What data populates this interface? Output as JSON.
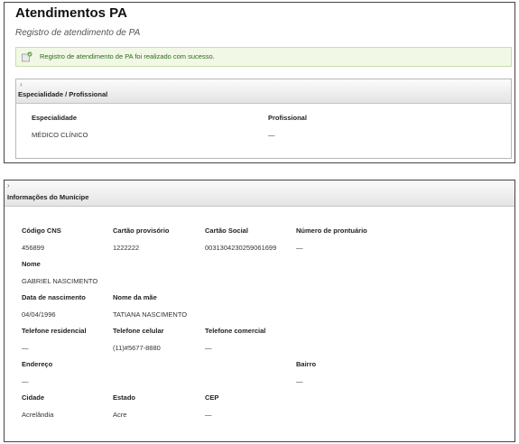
{
  "header": {
    "title": "Atendimentos PA",
    "subtitle": "Registro de atendimento de PA"
  },
  "alert": {
    "message": "Registro de atendimento de PA foi realizado com sucesso.",
    "icon": "success-message-icon"
  },
  "especialidade_section": {
    "toggle_icon": "›",
    "title": "Especialidade / Profissional",
    "fields": [
      {
        "label": "Especialidade",
        "value": "MÉDICO CLÍNICO"
      },
      {
        "label": "Profissional",
        "value": "—"
      }
    ]
  },
  "municipe_section": {
    "toggle_icon": "›",
    "title": "Informações do Munícipe",
    "fields": {
      "codigo_cns": {
        "label": "Código CNS",
        "value": "456899"
      },
      "cartao_provisorio": {
        "label": "Cartão provisório",
        "value": "1222222"
      },
      "cartao_social": {
        "label": "Cartão Social",
        "value": "0031304230259061699"
      },
      "numero_prontuario": {
        "label": "Número de prontuário",
        "value": "—"
      },
      "nome": {
        "label": "Nome",
        "value": "GABRIEL NASCIMENTO"
      },
      "data_nascimento": {
        "label": "Data de nascimento",
        "value": "04/04/1996"
      },
      "nome_mae": {
        "label": "Nome da mãe",
        "value": "TATIANA NASCIMENTO"
      },
      "telefone_residencial": {
        "label": "Telefone residencial",
        "value": "—"
      },
      "telefone_celular": {
        "label": "Telefone celular",
        "value": "(11)#5677-8880"
      },
      "telefone_comercial": {
        "label": "Telefone comercial",
        "value": "—"
      },
      "endereco": {
        "label": "Endereço",
        "value": "—"
      },
      "bairro": {
        "label": "Bairro",
        "value": "—"
      },
      "cidade": {
        "label": "Cidade",
        "value": "Acrelândia"
      },
      "estado": {
        "label": "Estado",
        "value": "Acre"
      },
      "cep": {
        "label": "CEP",
        "value": "—"
      }
    }
  },
  "colors": {
    "success_background": "#f1f8e6",
    "success_text": "#2f6a1b",
    "header_gradient_top": "#fbfbfb",
    "header_gradient_bottom": "#e4e4e4"
  }
}
